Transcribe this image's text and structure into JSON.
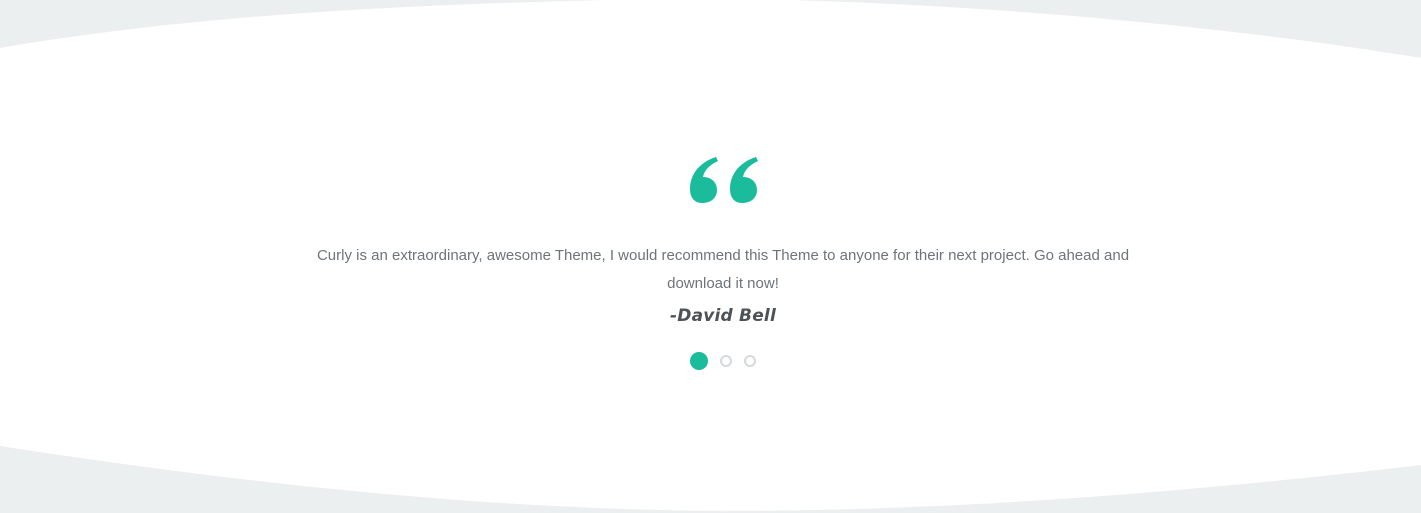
{
  "colors": {
    "accent": "#1bbc9b",
    "wave": "#eceff0",
    "text": "#6f7479",
    "author": "#4d5257",
    "dot_inactive": "#d5d9dc"
  },
  "testimonial": {
    "quote_icon": "quote-open-icon",
    "text": "Curly is an extraordinary, awesome Theme, I would recommend this Theme to anyone for their next project. Go ahead and download it now!",
    "author": "-David Bell"
  },
  "pagination": {
    "total": 3,
    "active_index": 0
  }
}
